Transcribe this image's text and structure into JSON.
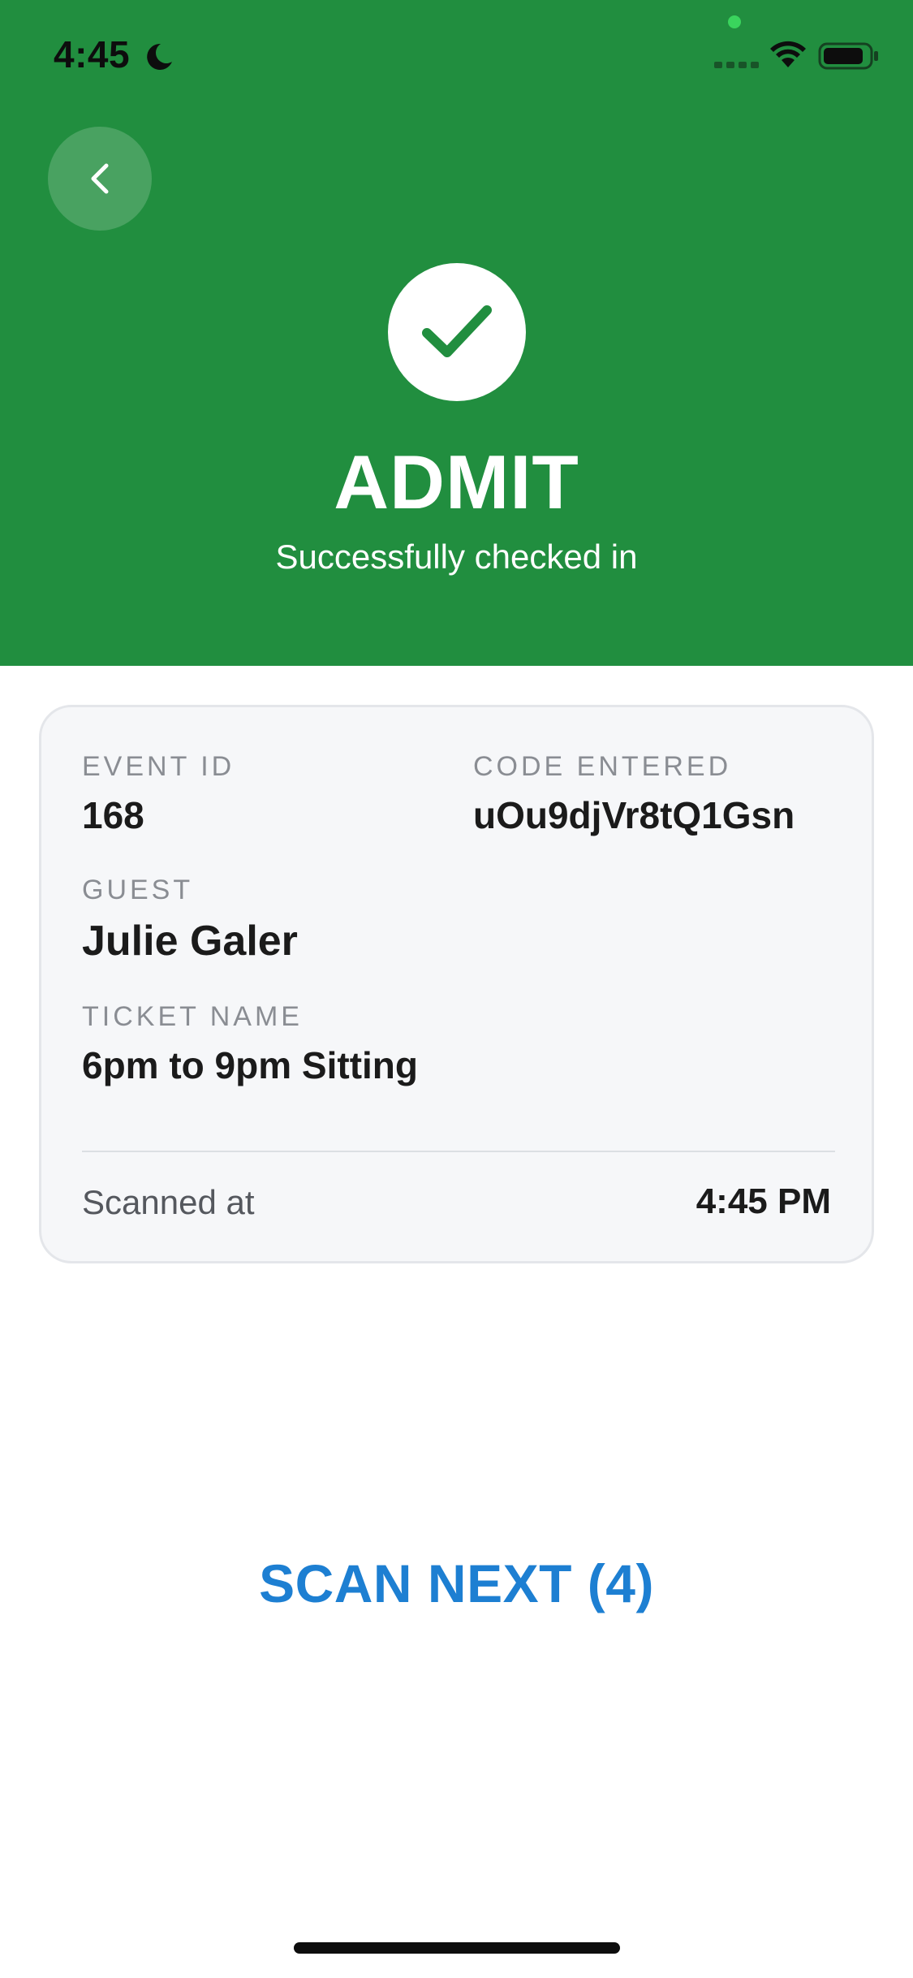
{
  "status_bar": {
    "time": "4:45"
  },
  "header": {
    "title": "ADMIT",
    "subtitle": "Successfully checked in",
    "background_color": "#218e3f"
  },
  "details": {
    "event_id_label": "EVENT ID",
    "event_id_value": "168",
    "code_label": "CODE ENTERED",
    "code_value": "uOu9djVr8tQ1Gsn",
    "guest_label": "GUEST",
    "guest_value": "Julie Galer",
    "ticket_label": "TICKET NAME",
    "ticket_value": "6pm to 9pm Sitting",
    "scanned_label": "Scanned at",
    "scanned_value": "4:45 PM"
  },
  "actions": {
    "scan_next_label": "SCAN NEXT (4)",
    "accent_color": "#1d7fd2"
  },
  "icons": {
    "back": "chevron-left-icon",
    "check": "checkmark-icon",
    "moon": "moon-icon",
    "wifi": "wifi-icon",
    "battery": "battery-icon",
    "signal": "signal-icon"
  }
}
